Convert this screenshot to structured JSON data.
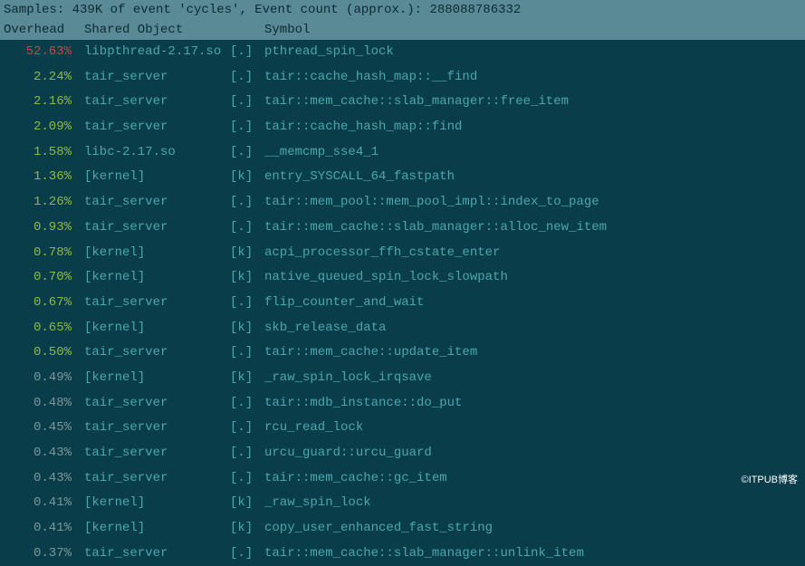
{
  "header": {
    "summary": "Samples: 439K of event 'cycles', Event count (approx.): 288088786332",
    "col_overhead": "Overhead",
    "col_shared": "Shared Object",
    "col_symbol": "Symbol"
  },
  "rows": [
    {
      "overhead": "52.63%",
      "overhead_color": "c-red",
      "shared": "libpthread-2.17.so",
      "shared_color": "c-teal",
      "tag": "[.]",
      "symbol": "pthread_spin_lock"
    },
    {
      "overhead": "2.24%",
      "overhead_color": "c-green",
      "shared": "tair_server",
      "shared_color": "c-teal",
      "tag": "[.]",
      "symbol": "tair::cache_hash_map::__find"
    },
    {
      "overhead": "2.16%",
      "overhead_color": "c-green",
      "shared": "tair_server",
      "shared_color": "c-teal",
      "tag": "[.]",
      "symbol": "tair::mem_cache::slab_manager::free_item"
    },
    {
      "overhead": "2.09%",
      "overhead_color": "c-green",
      "shared": "tair_server",
      "shared_color": "c-teal",
      "tag": "[.]",
      "symbol": "tair::cache_hash_map::find"
    },
    {
      "overhead": "1.58%",
      "overhead_color": "c-green",
      "shared": "libc-2.17.so",
      "shared_color": "c-teal",
      "tag": "[.]",
      "symbol": "__memcmp_sse4_1"
    },
    {
      "overhead": "1.36%",
      "overhead_color": "c-green",
      "shared": "[kernel]",
      "shared_color": "c-teal",
      "tag": "[k]",
      "symbol": "entry_SYSCALL_64_fastpath"
    },
    {
      "overhead": "1.26%",
      "overhead_color": "c-green",
      "shared": "tair_server",
      "shared_color": "c-teal",
      "tag": "[.]",
      "symbol": "tair::mem_pool::mem_pool_impl::index_to_page"
    },
    {
      "overhead": "0.93%",
      "overhead_color": "c-green",
      "shared": "tair_server",
      "shared_color": "c-teal",
      "tag": "[.]",
      "symbol": "tair::mem_cache::slab_manager::alloc_new_item"
    },
    {
      "overhead": "0.78%",
      "overhead_color": "c-green",
      "shared": "[kernel]",
      "shared_color": "c-teal",
      "tag": "[k]",
      "symbol": "acpi_processor_ffh_cstate_enter"
    },
    {
      "overhead": "0.70%",
      "overhead_color": "c-green",
      "shared": "[kernel]",
      "shared_color": "c-teal",
      "tag": "[k]",
      "symbol": "native_queued_spin_lock_slowpath"
    },
    {
      "overhead": "0.67%",
      "overhead_color": "c-green",
      "shared": "tair_server",
      "shared_color": "c-teal",
      "tag": "[.]",
      "symbol": "flip_counter_and_wait"
    },
    {
      "overhead": "0.65%",
      "overhead_color": "c-green",
      "shared": "[kernel]",
      "shared_color": "c-teal",
      "tag": "[k]",
      "symbol": "skb_release_data"
    },
    {
      "overhead": "0.50%",
      "overhead_color": "c-green",
      "shared": "tair_server",
      "shared_color": "c-teal",
      "tag": "[.]",
      "symbol": "tair::mem_cache::update_item"
    },
    {
      "overhead": "0.49%",
      "overhead_color": "c-dim",
      "shared": "[kernel]",
      "shared_color": "c-teal",
      "tag": "[k]",
      "symbol": "_raw_spin_lock_irqsave"
    },
    {
      "overhead": "0.48%",
      "overhead_color": "c-dim",
      "shared": "tair_server",
      "shared_color": "c-teal",
      "tag": "[.]",
      "symbol": "tair::mdb_instance::do_put"
    },
    {
      "overhead": "0.45%",
      "overhead_color": "c-dim",
      "shared": "tair_server",
      "shared_color": "c-teal",
      "tag": "[.]",
      "symbol": "rcu_read_lock"
    },
    {
      "overhead": "0.43%",
      "overhead_color": "c-dim",
      "shared": "tair_server",
      "shared_color": "c-teal",
      "tag": "[.]",
      "symbol": "urcu_guard::urcu_guard"
    },
    {
      "overhead": "0.43%",
      "overhead_color": "c-dim",
      "shared": "tair_server",
      "shared_color": "c-teal",
      "tag": "[.]",
      "symbol": "tair::mem_cache::gc_item"
    },
    {
      "overhead": "0.41%",
      "overhead_color": "c-dim",
      "shared": "[kernel]",
      "shared_color": "c-teal",
      "tag": "[k]",
      "symbol": "_raw_spin_lock"
    },
    {
      "overhead": "0.41%",
      "overhead_color": "c-dim",
      "shared": "[kernel]",
      "shared_color": "c-teal",
      "tag": "[k]",
      "symbol": "copy_user_enhanced_fast_string"
    },
    {
      "overhead": "0.37%",
      "overhead_color": "c-dim",
      "shared": "tair_server",
      "shared_color": "c-teal",
      "tag": "[.]",
      "symbol": "tair::mem_cache::slab_manager::unlink_item"
    }
  ],
  "watermark": "©ITPUB博客"
}
